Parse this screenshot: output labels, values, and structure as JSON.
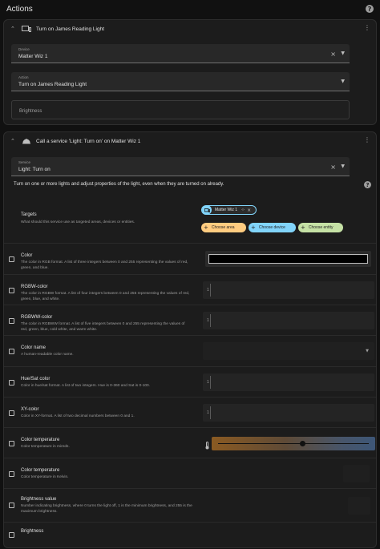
{
  "header": {
    "title": "Actions"
  },
  "action1": {
    "title": "Turn on James Reading Light",
    "device": {
      "label": "Device",
      "value": "Matter Wiz 1"
    },
    "action": {
      "label": "Action",
      "value": "Turn on James Reading Light"
    },
    "brightness": {
      "placeholder": "Brightness"
    }
  },
  "action2": {
    "title": "Call a service 'Light: Turn on' on Matter Wiz 1",
    "service": {
      "label": "Service",
      "value": "Light: Turn on"
    },
    "description": "Turn on one or more lights and adjust properties of the light, even when they are turned on already.",
    "targets": {
      "title": "Targets",
      "desc": "What should this service use as targeted areas, devices or entities.",
      "selected": "Matter Wiz 1",
      "choose_area": "Choose area",
      "choose_device": "Choose device",
      "choose_entity": "Choose entity"
    },
    "fields": [
      {
        "title": "Color",
        "desc": "The color in RGB format. A list of three integers between 0 and 255 representing the values of red, green, and blue."
      },
      {
        "title": "RGBW-color",
        "desc": "The color in RGBW format. A list of four integers between 0 and 255 representing the values of red, green, blue, and white.",
        "value": "1"
      },
      {
        "title": "RGBWW-color",
        "desc": "The color in RGBWW format. A list of five integers between 0 and 255 representing the values of red, green, blue, cold white, and warm white.",
        "value": "1"
      },
      {
        "title": "Color name",
        "desc": "A human-readable color name."
      },
      {
        "title": "Hue/Sat color",
        "desc": "Color in hue/sat format. A list of two integers. Hue is 0-360 and Sat is 0-100.",
        "value": "1"
      },
      {
        "title": "XY-color",
        "desc": "Color in XY-format. A list of two decimal numbers between 0 and 1.",
        "value": "1"
      },
      {
        "title": "Color temperature",
        "desc": "Color temperature in mireds."
      },
      {
        "title": "Color temperature",
        "desc": "Color temperature in Kelvin."
      },
      {
        "title": "Brightness value",
        "desc": "Number indicating brightness, where 0 turns the light off, 1 is the minimum brightness, and 255 is the maximum brightness."
      },
      {
        "title": "Brightness",
        "desc": ""
      }
    ],
    "color_temp_slider": 0.56
  },
  "colors": {
    "accent": "#03a9f4",
    "chip_area": "#ffcc80",
    "chip_device": "#81d4fa",
    "chip_entity": "#c5e1a5",
    "bg": "#111111",
    "card": "#1c1c1c"
  },
  "icons": {
    "help": "help-circle-icon",
    "kebab": "dots-vertical-icon",
    "close": "close-icon",
    "dropdown": "menu-down-icon",
    "collapse": "chevron-up-icon",
    "device": "devices-icon",
    "service": "room-service-icon",
    "thermometer": "thermometer-icon"
  }
}
